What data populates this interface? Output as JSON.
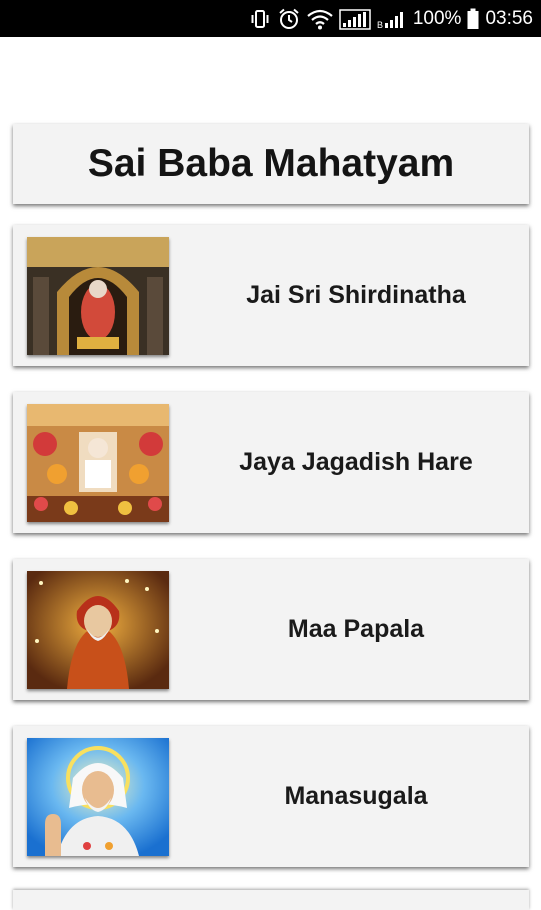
{
  "status_bar": {
    "battery": "100%",
    "time": "03:56",
    "icons": [
      "vibrate-icon",
      "alarm-icon",
      "wifi-icon",
      "signal-icon",
      "signal-icon",
      "battery-icon"
    ]
  },
  "title": "Sai Baba Mahatyam",
  "items": [
    {
      "label": "Jai Sri Shirdinatha",
      "icon": "temple-thumbnail"
    },
    {
      "label": "Jaya Jagadish Hare",
      "icon": "shrine-thumbnail"
    },
    {
      "label": "Maa Papala",
      "icon": "saint-portrait-thumbnail"
    },
    {
      "label": "Manasugala",
      "icon": "blessing-portrait-thumbnail"
    }
  ]
}
